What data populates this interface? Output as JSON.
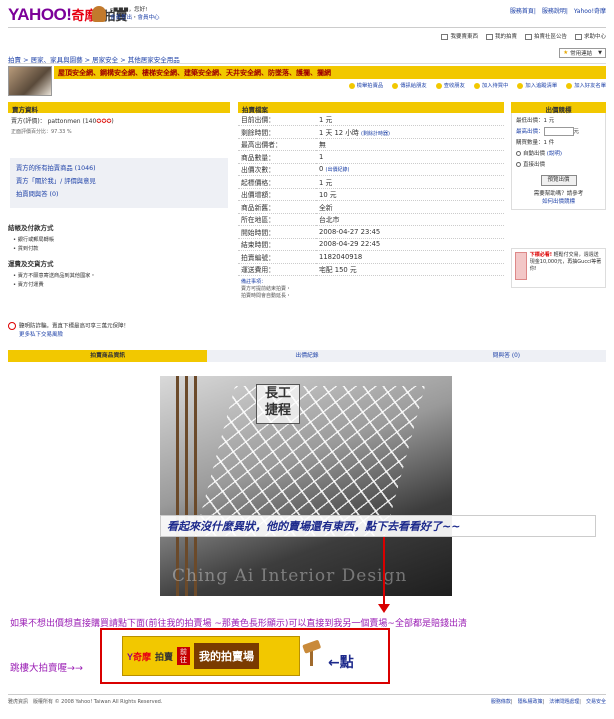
{
  "header": {
    "logo_yahoo": "YAHOO!",
    "logo_kimo": "奇摩",
    "logo_sub": "拍賣",
    "greeting": "c■■■，您好!",
    "account_links": [
      "會員登出",
      "會員中心"
    ],
    "top_links": [
      "服務首頁",
      "服務說明",
      "Yahoo!奇摩"
    ]
  },
  "toolbar": {
    "items": [
      "我要賣東西",
      "我的拍賣",
      "拍賣社區公告",
      "求助中心"
    ],
    "favorites_label": "常用連結"
  },
  "breadcrumb": "拍賣 > 居家、家具與園藝 > 居家安全 > 其他居家安全用品",
  "category_bar": "屋頂安全網、鋼構安全網、樓梯安全網、建築安全網、天井安全網、防墜落、護攔、攔網",
  "actions": [
    "檢舉拍賣品",
    "傳訊給朋友",
    "查收朋友",
    "加入待買中",
    "加入追蹤清單",
    "加入好友名單"
  ],
  "seller": {
    "title": "賣方資料",
    "seller_line": "賣方(評價)： pattonmen (140",
    "rating_stars": "✪✪✪",
    "positive_rate": "正面評價百分比：97.33 %",
    "links": [
      "賣方的所有拍賣商品 (1046)",
      "賣方「關於我」/ 評價與意見",
      "拍賣問與答 (0)"
    ],
    "payment_title": "結帳及付款方式",
    "payment_items": [
      "銀行或郵局轉帳",
      "貨到付款"
    ],
    "shipping_title": "運費及交貨方式",
    "shipping_items": [
      "賣方不願意寄送商品到其他國家・",
      "賣方付運費"
    ],
    "warning": "聽明防詐騙，賣直下標最高可享三萬元保障！",
    "warning_link": "更多私下交易風險"
  },
  "details": {
    "title": "拍賣檔案",
    "rows": [
      {
        "k": "目前出價：",
        "v": "1 元",
        "note": ""
      },
      {
        "k": "剩餘時間：",
        "v": "1 天 12 小時",
        "note": "(剩餘計時器)"
      },
      {
        "k": "最高出價者：",
        "v": "無",
        "note": ""
      },
      {
        "k": "商品數量：",
        "v": "1",
        "note": ""
      },
      {
        "k": "出價次數：",
        "v": "0",
        "note": "(出價紀錄)"
      },
      {
        "k": "起標價格：",
        "v": "1 元",
        "note": ""
      },
      {
        "k": "出價增額：",
        "v": "10 元",
        "note": ""
      },
      {
        "k": "商品新舊：",
        "v": "全新",
        "note": ""
      },
      {
        "k": "所在地區：",
        "v": "台北市",
        "note": ""
      },
      {
        "k": "開始時間：",
        "v": "2008-04-27 23:45",
        "note": ""
      },
      {
        "k": "結束時間：",
        "v": "2008-04-29 22:45",
        "note": ""
      },
      {
        "k": "拍賣編號：",
        "v": "1182040918",
        "note": ""
      },
      {
        "k": "運送費用：",
        "v": "宅配 150 元",
        "note": ""
      }
    ],
    "notes_title": "備註事項：",
    "notes": [
      "賣方可提前結束拍賣・",
      "拍賣時間會自動延長・"
    ]
  },
  "bid": {
    "title": "出價競標",
    "min_label": "最低出價：",
    "min_value": "1 元",
    "price_label": "最高出價：",
    "unit": "元",
    "qty_label": "購買數量：",
    "qty_value": "1 件",
    "auto_bid": "自動出價",
    "auto_bid_note": "(說明)",
    "direct_bid": "直接出價",
    "button": "預覽出價",
    "help": "需要幫助嗎？請參考",
    "help_link": "如何出價競標"
  },
  "promo": {
    "title": "下標必看!",
    "text": "輕鬆付交易，週週送現金10,000元，再抽Gucci等著你!"
  },
  "tabs": [
    "拍賣商品資訊",
    "出價紀錄",
    "問與答 (0)"
  ],
  "photo": {
    "stamp_top": "長工",
    "stamp_bottom": "捷程",
    "watermark": "Ching Ai Interior Design",
    "caption": "看起來沒什麼異狀，他的賣場還有東西，點下去看看好了~~"
  },
  "annotation": {
    "line1": "如果不想出價想直接購買請點下面(前往我的拍賣場 ~那黃色長形顯示)可以直接到我另一個賣場~全部都是賠錢出清",
    "line2": "跳樓大拍賣喔→→",
    "banner_kimo": "奇摩",
    "banner_sub": "拍賣",
    "banner_go": "前往",
    "banner_name": "我的拍賣場",
    "point": "←點"
  },
  "footer": {
    "copyright": "雅虎資訊　版權所有 © 2008 Yahoo! Taiwan All Rights Reserved.",
    "links": [
      "服務條款",
      "隱私權政策",
      "法律問題處理",
      "交易安全"
    ]
  }
}
